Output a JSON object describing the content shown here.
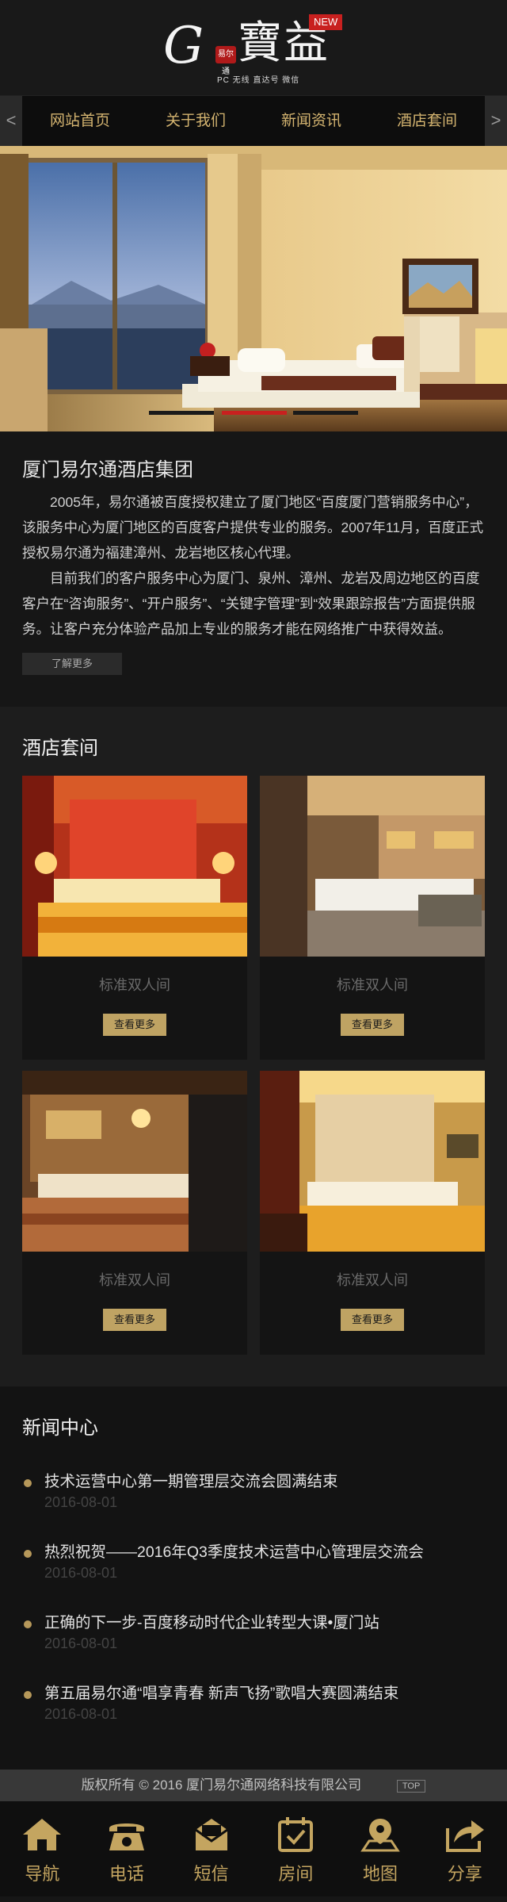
{
  "brand": {
    "logo_letter": "G",
    "logo_seal": "易尔通",
    "logo_name": "寶益",
    "new_badge": "NEW",
    "tagline": "PC 无线 直达号 微信"
  },
  "nav": {
    "prev": "<",
    "next": ">",
    "items": [
      "网站首页",
      "关于我们",
      "新闻资讯",
      "酒店套间"
    ]
  },
  "intro": {
    "title": "厦门易尔通酒店集团",
    "paragraphs": [
      "2005年，易尔通被百度授权建立了厦门地区“百度厦门营销服务中心”，该服务中心为厦门地区的百度客户提供专业的服务。2007年11月，百度正式授权易尔通为福建漳州、龙岩地区核心代理。",
      "目前我们的客户服务中心为厦门、泉州、漳州、龙岩及周边地区的百度客户在“咨询服务”、“开户服务”、“关键字管理”到“效果跟踪报告”方面提供服务。让客户充分体验产品加上专业的服务才能在网络推广中获得效益。"
    ],
    "more": "了解更多"
  },
  "rooms": {
    "title": "酒店套间",
    "items": [
      {
        "name": "标准双人间",
        "button": "查看更多"
      },
      {
        "name": "标准双人间",
        "button": "查看更多"
      },
      {
        "name": "标准双人间",
        "button": "查看更多"
      },
      {
        "name": "标准双人间",
        "button": "查看更多"
      }
    ]
  },
  "news": {
    "title": "新闻中心",
    "items": [
      {
        "title": "技术运营中心第一期管理层交流会圆满结束",
        "date": "2016-08-01"
      },
      {
        "title": "热烈祝贺——2016年Q3季度技术运营中心管理层交流会",
        "date": "2016-08-01"
      },
      {
        "title": "正确的下一步-百度移动时代企业转型大课•厦门站",
        "date": "2016-08-01"
      },
      {
        "title": "第五届易尔通“唱享青春 新声飞扬”歌唱大赛圆满结束",
        "date": "2016-08-01"
      }
    ]
  },
  "footer": {
    "copyright": "版权所有 © 2016 厦门易尔通网络科技有限公司",
    "top": "TOP"
  },
  "toolbar": {
    "items": [
      {
        "label": "导航",
        "icon": "home-icon"
      },
      {
        "label": "电话",
        "icon": "phone-icon"
      },
      {
        "label": "短信",
        "icon": "mail-icon"
      },
      {
        "label": "房间",
        "icon": "calendar-check-icon"
      },
      {
        "label": "地图",
        "icon": "map-pin-icon"
      },
      {
        "label": "分享",
        "icon": "share-icon"
      }
    ]
  },
  "colors": {
    "accent": "#c4a560",
    "nav_text": "#d4b470",
    "active_dot": "#c8201f"
  }
}
